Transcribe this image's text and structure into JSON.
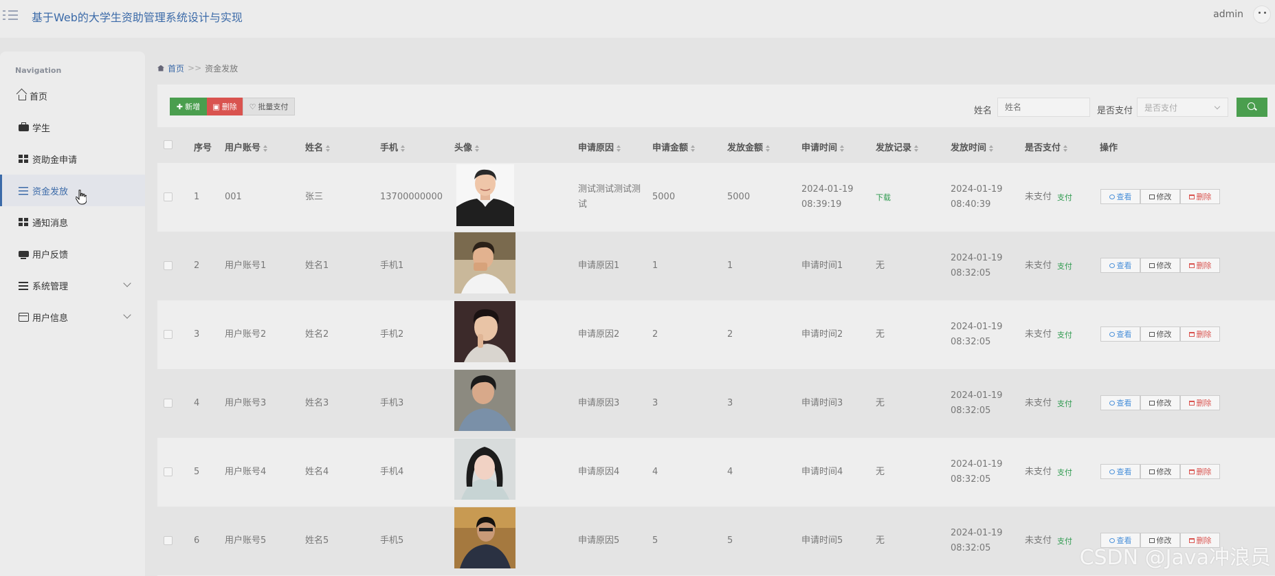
{
  "header": {
    "title": "基于Web的大学生资助管理系统设计与实现",
    "user": "admin"
  },
  "sidebar": {
    "caption": "Navigation",
    "items": [
      {
        "label": "首页",
        "icon": "home-icon"
      },
      {
        "label": "学生",
        "icon": "briefcase-icon"
      },
      {
        "label": "资助金申请",
        "icon": "grid-icon"
      },
      {
        "label": "资金发放",
        "icon": "sliders-icon",
        "active": true
      },
      {
        "label": "通知消息",
        "icon": "grid-icon"
      },
      {
        "label": "用户反馈",
        "icon": "monitor-icon"
      },
      {
        "label": "系统管理",
        "icon": "bars-icon",
        "expandable": true
      },
      {
        "label": "用户信息",
        "icon": "window-icon",
        "expandable": true
      }
    ]
  },
  "breadcrumb": {
    "home": "首页",
    "separator": ">>",
    "current": "资金发放"
  },
  "toolbar": {
    "add_label": "新增",
    "delete_label": "删除",
    "batch_pay_label": "批量支付",
    "name_label": "姓名",
    "name_placeholder": "姓名",
    "paid_label": "是否支付",
    "paid_placeholder": "是否支付"
  },
  "table": {
    "headers": [
      "序号",
      "用户账号",
      "姓名",
      "手机",
      "头像",
      "申请原因",
      "申请金额",
      "发放金额",
      "申请时间",
      "发放记录",
      "发放时间",
      "是否支付",
      "操作"
    ],
    "pay_link": "支付",
    "view_label": "查看",
    "edit_label": "修改",
    "delete_label": "删除",
    "rows": [
      {
        "index": "1",
        "account": "001",
        "name": "张三",
        "phone": "13700000000",
        "reason": "测试测试测试测试",
        "apply_amount": "5000",
        "issue_amount": "5000",
        "apply_time": "2024-01-19 08:39:19",
        "record": "下载",
        "issue_time": "2024-01-19 08:40:39",
        "paid": "未支付"
      },
      {
        "index": "2",
        "account": "用户账号1",
        "name": "姓名1",
        "phone": "手机1",
        "reason": "申请原因1",
        "apply_amount": "1",
        "issue_amount": "1",
        "apply_time": "申请时间1",
        "record": "无",
        "issue_time": "2024-01-19 08:32:05",
        "paid": "未支付"
      },
      {
        "index": "3",
        "account": "用户账号2",
        "name": "姓名2",
        "phone": "手机2",
        "reason": "申请原因2",
        "apply_amount": "2",
        "issue_amount": "2",
        "apply_time": "申请时间2",
        "record": "无",
        "issue_time": "2024-01-19 08:32:05",
        "paid": "未支付"
      },
      {
        "index": "4",
        "account": "用户账号3",
        "name": "姓名3",
        "phone": "手机3",
        "reason": "申请原因3",
        "apply_amount": "3",
        "issue_amount": "3",
        "apply_time": "申请时间3",
        "record": "无",
        "issue_time": "2024-01-19 08:32:05",
        "paid": "未支付"
      },
      {
        "index": "5",
        "account": "用户账号4",
        "name": "姓名4",
        "phone": "手机4",
        "reason": "申请原因4",
        "apply_amount": "4",
        "issue_amount": "4",
        "apply_time": "申请时间4",
        "record": "无",
        "issue_time": "2024-01-19 08:32:05",
        "paid": "未支付"
      },
      {
        "index": "6",
        "account": "用户账号5",
        "name": "姓名5",
        "phone": "手机5",
        "reason": "申请原因5",
        "apply_amount": "5",
        "issue_amount": "5",
        "apply_time": "申请时间5",
        "record": "无",
        "issue_time": "2024-01-19 08:32:05",
        "paid": "未支付"
      }
    ]
  },
  "watermark": "CSDN @Java冲浪员",
  "colors": {
    "accent": "#3b6aa8",
    "success": "#4a9e4e",
    "danger": "#d9534f"
  }
}
